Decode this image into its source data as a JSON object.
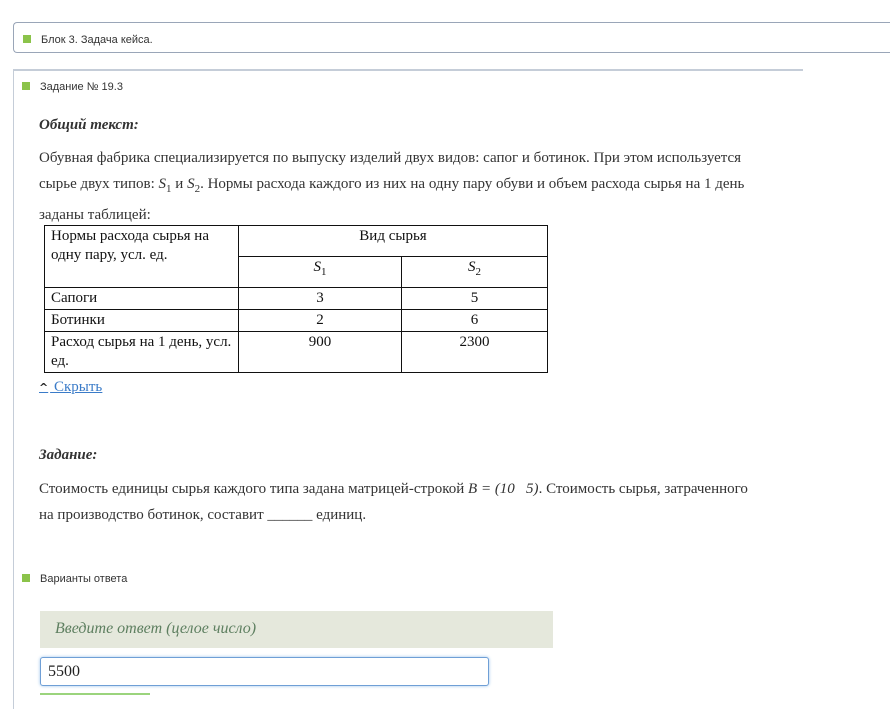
{
  "block": {
    "title": "Блок 3. Задача кейса."
  },
  "task": {
    "number_label": "Задание № 19.3"
  },
  "common_text": {
    "heading": "Общий текст:",
    "line1": "Обувная фабрика специализируется по выпуску изделий двух видов: сапог и ботинок. При этом используется",
    "line2_prefix": "сырье двух типов:",
    "s1": "S",
    "s1_sub": "1",
    "and_word": "и",
    "s2": "S",
    "s2_sub": "2",
    "line2_suffix": ". Нормы расхода каждого из них на одну пару обуви и объем расхода сырья на 1 день",
    "line3": "заданы таблицей:"
  },
  "table": {
    "corner_header": "Нормы расхода сырья на одну пару, усл. ед.",
    "group_header": "Вид сырья",
    "col1_symbol": "S",
    "col1_sub": "1",
    "col2_symbol": "S",
    "col2_sub": "2",
    "rows": [
      {
        "label": "Сапоги",
        "s1": "3",
        "s2": "5"
      },
      {
        "label": "Ботинки",
        "s1": "2",
        "s2": "6"
      },
      {
        "label": "Расход сырья на 1 день, усл. ед.",
        "s1": "900",
        "s2": "2300"
      }
    ]
  },
  "hide_link": {
    "label": " Скрыть"
  },
  "assignment": {
    "heading": "Задание:",
    "line1_prefix": "Стоимость единицы сырья каждого типа задана матрицей-строкой",
    "matrix_expr": "B = (10   5)",
    "line1_suffix": ". Стоимость сырья, затраченного",
    "line2": "на производство ботинок, составит ______ единиц."
  },
  "answers": {
    "section_label": "Варианты ответа",
    "prompt": "Введите ответ (целое число)",
    "input_value": "5500"
  },
  "colors": {
    "accent_green": "#8bc34a",
    "link_blue": "#3a7bc8",
    "prompt_bg": "#e5e8dc",
    "prompt_text": "#5e7f60"
  }
}
